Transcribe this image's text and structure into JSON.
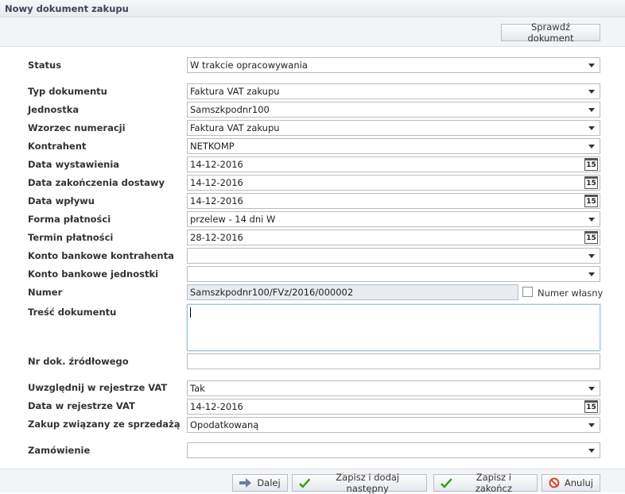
{
  "window": {
    "title": "Nowy dokument zakupu"
  },
  "toolbar": {
    "check_label": "Sprawdź dokument"
  },
  "form": {
    "status": {
      "label": "Status",
      "value": "W trakcie opracowywania"
    },
    "typ_dokumentu": {
      "label": "Typ dokumentu",
      "value": "Faktura VAT zakupu"
    },
    "jednostka": {
      "label": "Jednostka",
      "value": "Samszkpodnr100"
    },
    "wzorzec_numeracji": {
      "label": "Wzorzec numeracji",
      "value": "Faktura VAT zakupu"
    },
    "kontrahent": {
      "label": "Kontrahent",
      "value": "NETKOMP"
    },
    "data_wystawienia": {
      "label": "Data wystawienia",
      "value": "14-12-2016"
    },
    "data_zakonczenia_dostawy": {
      "label": "Data zakończenia dostawy",
      "value": "14-12-2016"
    },
    "data_wplywu": {
      "label": "Data wpływu",
      "value": "14-12-2016"
    },
    "forma_platnosci": {
      "label": "Forma płatności",
      "value": "przelew - 14 dni W"
    },
    "termin_platnosci": {
      "label": "Termin płatności",
      "value": "28-12-2016"
    },
    "konto_bankowe_kontrahenta": {
      "label": "Konto bankowe kontrahenta",
      "value": ""
    },
    "konto_bankowe_jednostki": {
      "label": "Konto bankowe jednostki",
      "value": ""
    },
    "numer": {
      "label": "Numer",
      "value": "Samszkpodnr100/FVz/2016/000002",
      "own_number_label": "Numer własny"
    },
    "tresc_dokumentu": {
      "label": "Treść dokumentu",
      "value": ""
    },
    "nr_dok_zrodlowego": {
      "label": "Nr dok. źródłowego",
      "value": ""
    },
    "uwzglednij_vat": {
      "label": "Uwzględnij w rejestrze VAT",
      "value": "Tak"
    },
    "data_rejestr_vat": {
      "label": "Data w rejestrze VAT",
      "value": "14-12-2016"
    },
    "zakup_sprzedaz": {
      "label": "Zakup związany ze sprzedażą",
      "value": "Opodatkowaną"
    },
    "zamowienie": {
      "label": "Zamówienie",
      "value": ""
    },
    "calendar_icon_text": "15"
  },
  "footer": {
    "next_label": "Dalej",
    "save_add_label": "Zapisz i dodaj następny",
    "save_close_label": "Zapisz i zakończ",
    "cancel_label": "Anuluj"
  },
  "colors": {
    "check_green": "#3a9a1c",
    "next_arrow": "#6c7f95",
    "cancel_red": "#d9452b"
  }
}
